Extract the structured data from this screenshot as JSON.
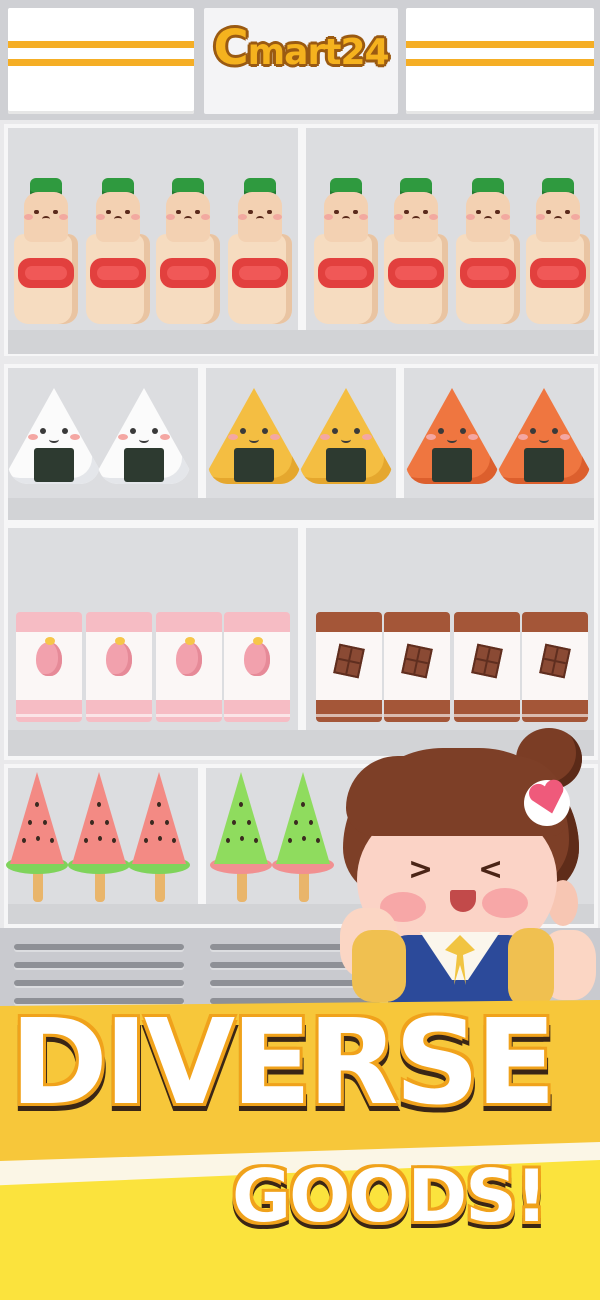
{
  "header": {
    "logo_initial": "C",
    "logo_word": "mart",
    "logo_number": "24"
  },
  "banner": {
    "line1": "DIVERSE",
    "line2": "GOODS!"
  },
  "colors": {
    "header_stripe": "#f5ae25",
    "banner_yellow": "#f7c73a",
    "text_outline": "#f0a21b"
  }
}
